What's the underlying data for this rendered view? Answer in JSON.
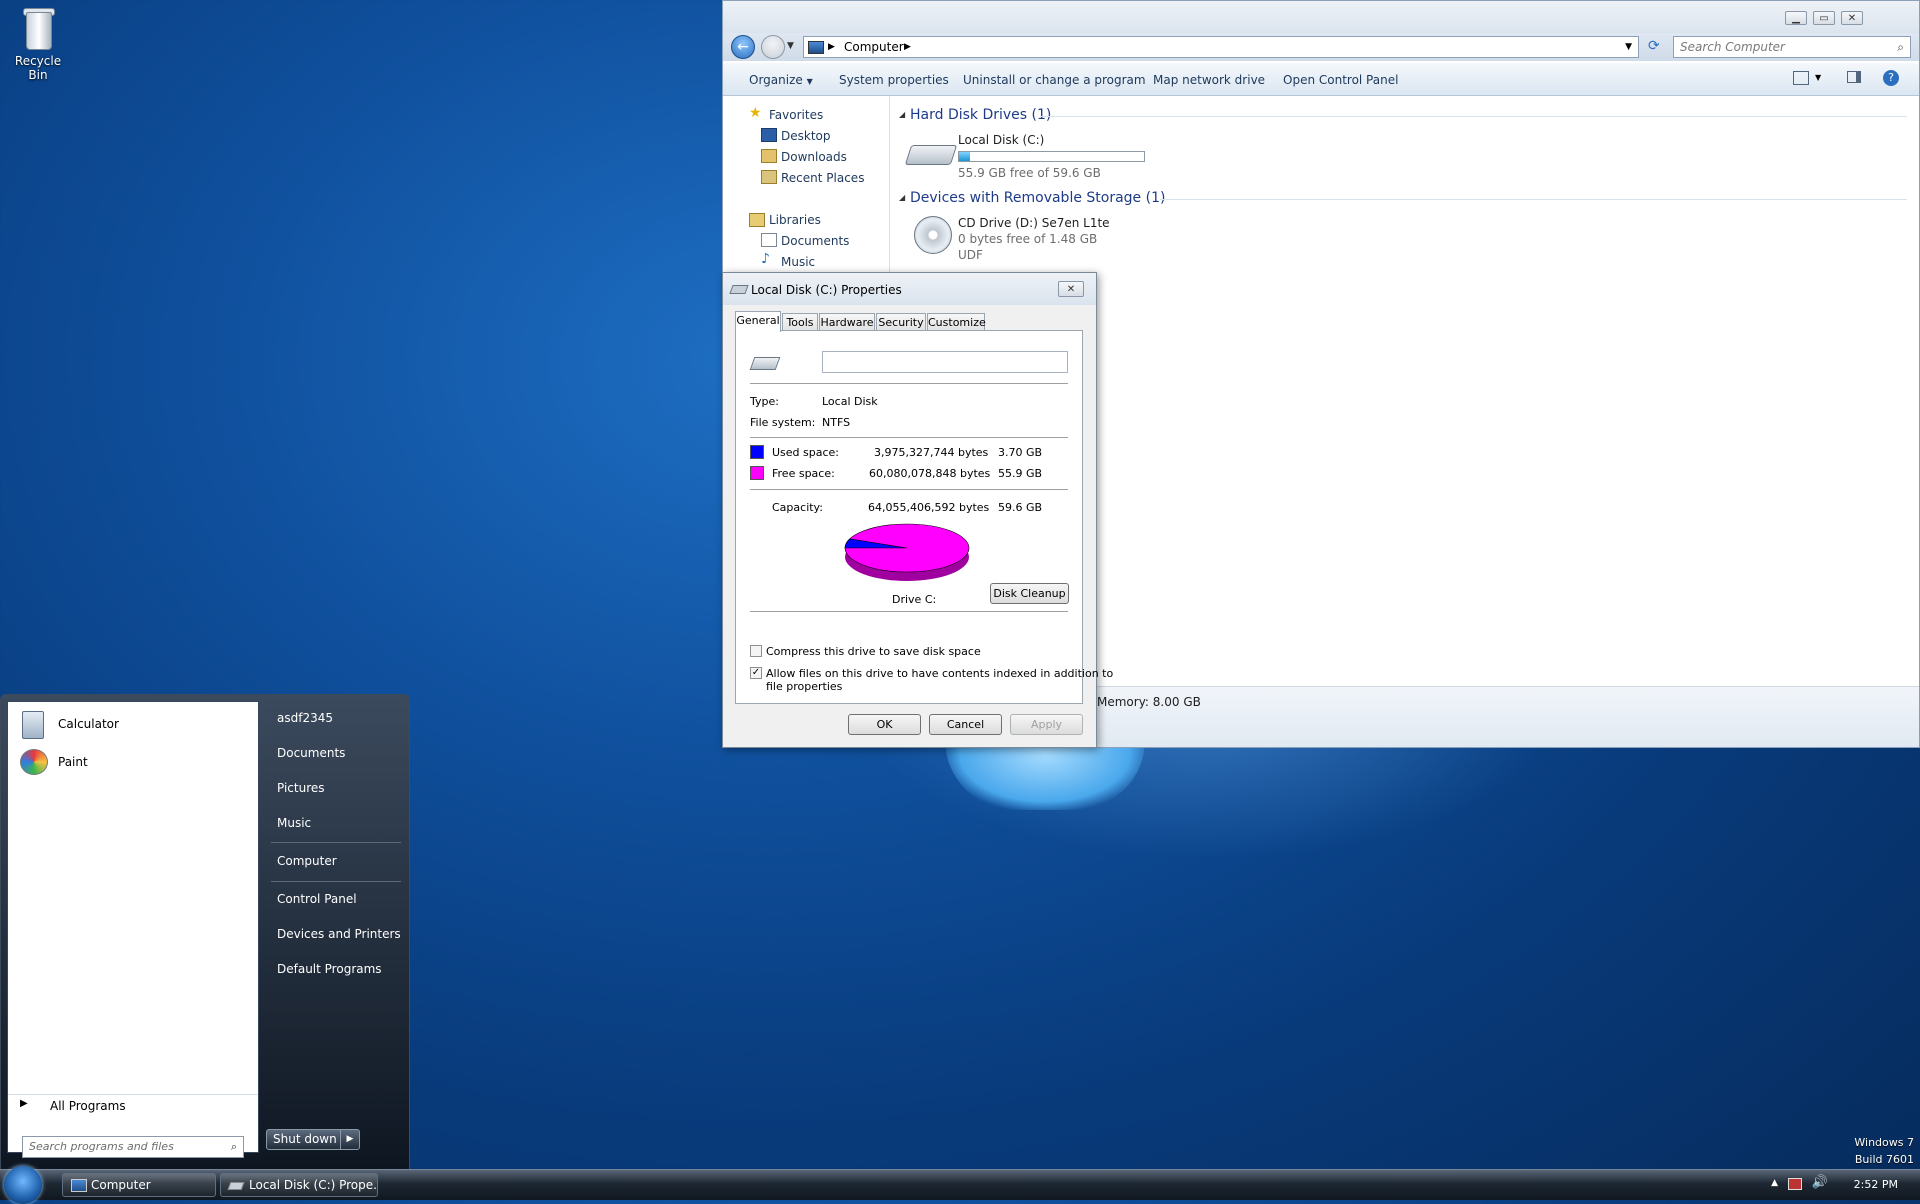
{
  "desktop": {
    "recycle_bin_label": "Recycle Bin",
    "watermark_line1": "Windows 7",
    "watermark_line2": "Build 7601"
  },
  "explorer": {
    "breadcrumb_root": "Computer",
    "search_placeholder": "Search Computer",
    "toolbar": {
      "organize": "Organize",
      "system_properties": "System properties",
      "uninstall": "Uninstall or change a program",
      "map_drive": "Map network drive",
      "open_control_panel": "Open Control Panel"
    },
    "nav": {
      "favorites": "Favorites",
      "desktop": "Desktop",
      "downloads": "Downloads",
      "recent": "Recent Places",
      "libraries": "Libraries",
      "documents": "Documents",
      "music": "Music"
    },
    "groups": {
      "hdd_header": "Hard Disk Drives (1)",
      "removable_header": "Devices with Removable Storage (1)"
    },
    "drives": {
      "c_name": "Local Disk (C:)",
      "c_free": "55.9 GB free of 59.6 GB",
      "c_used_fraction": 0.062,
      "d_name": "CD Drive (D:) Se7en L1te",
      "d_free": "0 bytes free of 1.48 GB",
      "d_fs": "UDF"
    },
    "details_memory": "Memory: 8.00 GB"
  },
  "dialog": {
    "title": "Local Disk (C:) Properties",
    "tabs": [
      "General",
      "Tools",
      "Hardware",
      "Security",
      "Customize"
    ],
    "name_value": "",
    "type_label": "Type:",
    "type_value": "Local Disk",
    "fs_label": "File system:",
    "fs_value": "NTFS",
    "used_label": "Used space:",
    "used_bytes": "3,975,327,744 bytes",
    "used_gb": "3.70 GB",
    "free_label": "Free space:",
    "free_bytes": "60,080,078,848 bytes",
    "free_gb": "55.9 GB",
    "capacity_label": "Capacity:",
    "capacity_bytes": "64,055,406,592 bytes",
    "capacity_gb": "59.6 GB",
    "drive_label": "Drive C:",
    "disk_cleanup": "Disk Cleanup",
    "compress_label": "Compress this drive to save disk space",
    "index_label_1": "Allow files on this drive to have contents indexed in addition to",
    "index_label_2": "file properties",
    "ok": "OK",
    "cancel": "Cancel",
    "apply": "Apply",
    "used_color": "#0000ff",
    "free_color": "#ff00ff"
  },
  "startmenu": {
    "programs": [
      "Calculator",
      "Paint"
    ],
    "all_programs": "All Programs",
    "search_placeholder": "Search programs and files",
    "right": {
      "user": "asdf2345",
      "documents": "Documents",
      "pictures": "Pictures",
      "music": "Music",
      "computer": "Computer",
      "control_panel": "Control Panel",
      "devices": "Devices and Printers",
      "default_programs": "Default Programs"
    },
    "shutdown": "Shut down"
  },
  "taskbar": {
    "items": [
      "Computer",
      "Local Disk (C:) Prope..."
    ],
    "time": "2:52 PM"
  }
}
